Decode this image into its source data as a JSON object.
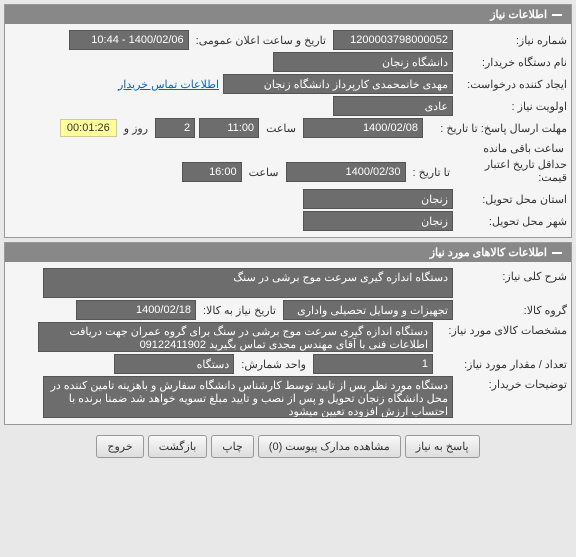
{
  "panel1": {
    "title": "اطلاعات نیاز",
    "row1": {
      "label": "شماره نیاز:",
      "value": "1200003798000052",
      "label2": "تاریخ و ساعت اعلان عمومی:",
      "value2": "1400/02/06 - 10:44"
    },
    "row2": {
      "label": "نام دستگاه خریدار:",
      "value": "دانشگاه زنجان"
    },
    "row3": {
      "label": "ایجاد کننده درخواست:",
      "value": "مهدی خانمحمدی کارپرداز دانشگاه زنجان",
      "link": "اطلاعات تماس خریدار"
    },
    "row4": {
      "label": "اولویت نیاز :",
      "value": "عادی"
    },
    "row5": {
      "label": "مهلت ارسال پاسخ:  تا تاریخ :",
      "date": "1400/02/08",
      "time_label": "ساعت",
      "time": "11:00",
      "days": "2",
      "days_label": "روز و",
      "countdown": "00:01:26",
      "remaining": "ساعت باقی مانده"
    },
    "row6": {
      "label": "حداقل تاریخ اعتبار قیمت:",
      "sub_label": "تا تاریخ :",
      "date": "1400/02/30",
      "time_label": "ساعت",
      "time": "16:00"
    },
    "row7": {
      "label": "استان محل تحویل:",
      "value": "زنجان"
    },
    "row8": {
      "label": "شهر محل تحویل:",
      "value": "زنجان"
    }
  },
  "panel2": {
    "title": "اطلاعات کالاهای مورد نیاز",
    "row1": {
      "label": "شرح کلی نیاز:",
      "value": "دستگاه اندازه گیری سرعت موج برشی در سنگ"
    },
    "row2": {
      "label": "گروه کالا:",
      "value": "تجهیزات و وسایل تحصیلی واداری",
      "label2": "تاریخ نیاز به کالا:",
      "value2": "1400/02/18"
    },
    "row3": {
      "label": "مشخصات کالای مورد نیاز:",
      "value": "دستگاه اندازه گیری سرعت موج برشی در سنگ برای گروه عمران جهت دریافت اطلاعات فنی با آقای مهندس مجدی تماس بگیرید 09122411902"
    },
    "row4": {
      "label": "تعداد / مقدار مورد نیاز:",
      "value": "1",
      "label2": "واحد شمارش:",
      "value2": "دستگاه"
    },
    "row5": {
      "label": "توضیحات خریدار:",
      "value": "دستگاه مورد نظر پس از تایید توسط کارشناس دانشگاه سفارش و باهزینه تامین کننده در محل دانشگاه زنجان تحویل و پس از نصب و تایید مبلغ تسویه خواهد شد ضمنا برنده با احتساب ارزش افزوده تعیین میشود"
    }
  },
  "buttons": {
    "reply": "پاسخ به نیاز",
    "docs": "مشاهده مدارک پیوست (0)",
    "print": "چاپ",
    "back": "بازگشت",
    "exit": "خروج"
  }
}
